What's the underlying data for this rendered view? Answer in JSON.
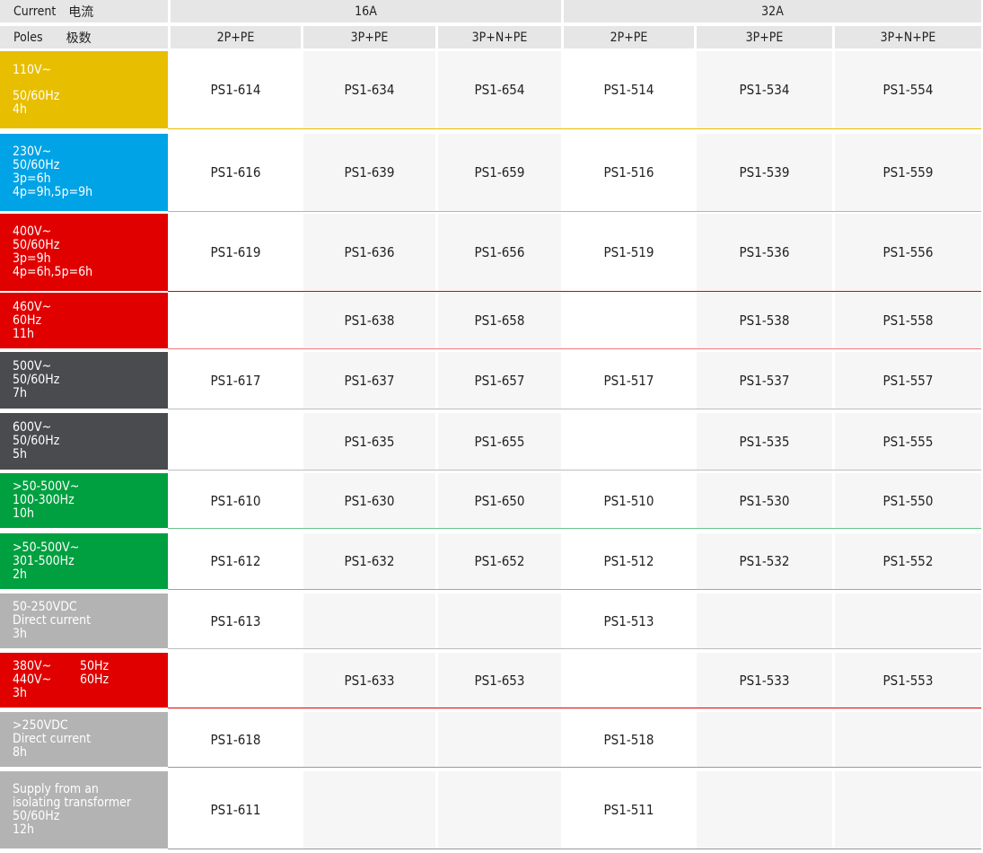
{
  "header": {
    "current_label": "Current",
    "current_cn": "电流",
    "poles_label": "Poles",
    "poles_cn": "极数",
    "groups": [
      {
        "label": "16A",
        "poles": [
          "2P+PE",
          "3P+PE",
          "3P+N+PE"
        ]
      },
      {
        "label": "32A",
        "poles": [
          "2P+PE",
          "3P+PE",
          "3P+N+PE"
        ]
      }
    ]
  },
  "rows": [
    {
      "color": "#e8be00",
      "line_color": "#e8be00",
      "label": [
        "110V~",
        "",
        "50/60Hz",
        "4h"
      ],
      "codes": [
        "PS1-614",
        "PS1-634",
        "PS1-654",
        "PS1-514",
        "PS1-534",
        "PS1-554"
      ]
    },
    {
      "color": "#00a3e6",
      "line_color": "#73c9ee",
      "label": [
        "230V~",
        "50/60Hz",
        "3p=6h",
        "4p=9h,5p=9h"
      ],
      "codes": [
        "PS1-616",
        "PS1-639",
        "PS1-659",
        "PS1-516",
        "PS1-539",
        "PS1-559"
      ]
    },
    {
      "color": "#e10000",
      "line_color": "#e10000",
      "label": [
        "400V~",
        "50/60Hz",
        "3p=9h",
        "4p=6h,5p=6h"
      ],
      "codes": [
        "PS1-619",
        "PS1-636",
        "PS1-656",
        "PS1-519",
        "PS1-536",
        "PS1-556"
      ]
    },
    {
      "color": "#e10000",
      "line_color": "#f07a7a",
      "label": [
        "460V~",
        "60Hz",
        "11h"
      ],
      "codes": [
        "",
        "PS1-638",
        "PS1-658",
        "",
        "PS1-538",
        "PS1-558"
      ]
    },
    {
      "color": "#4a4b4e",
      "line_color": "#bdbdbd",
      "label": [
        "500V~",
        "50/60Hz",
        "7h"
      ],
      "codes": [
        "PS1-617",
        "PS1-637",
        "PS1-657",
        "PS1-517",
        "PS1-537",
        "PS1-557"
      ]
    },
    {
      "color": "#4a4b4e",
      "line_color": "#bdbdbd",
      "label": [
        "600V~",
        "50/60Hz",
        "5h"
      ],
      "codes": [
        "",
        "PS1-635",
        "PS1-655",
        "",
        "PS1-535",
        "PS1-555"
      ]
    },
    {
      "color": "#00a040",
      "line_color": "#6cc48f",
      "label": [
        ">50-500V~",
        "100-300Hz",
        "10h"
      ],
      "codes": [
        "PS1-610",
        "PS1-630",
        "PS1-650",
        "PS1-510",
        "PS1-530",
        "PS1-550"
      ]
    },
    {
      "color": "#00a040",
      "line_color": "#6cc48f",
      "label": [
        ">50-500V~",
        "301-500Hz",
        "2h"
      ],
      "codes": [
        "PS1-612",
        "PS1-632",
        "PS1-652",
        "PS1-512",
        "PS1-532",
        "PS1-552"
      ]
    },
    {
      "color": "#b3b3b3",
      "line_color": "#bdbdbd",
      "label": [
        "50-250VDC",
        "Direct current",
        "3h"
      ],
      "codes": [
        "PS1-613",
        "",
        "",
        "PS1-513",
        "",
        ""
      ]
    },
    {
      "color": "#e10000",
      "line_color": "#e10000",
      "label": [
        "380V~",
        "440V~",
        "3h"
      ],
      "hz": [
        "50Hz",
        "60Hz"
      ],
      "codes": [
        "",
        "PS1-633",
        "PS1-653",
        "",
        "PS1-533",
        "PS1-553"
      ]
    },
    {
      "color": "#b3b3b3",
      "line_color": "#9a9a9a",
      "label": [
        ">250VDC",
        "Direct current",
        "8h"
      ],
      "codes": [
        "PS1-618",
        "",
        "",
        "PS1-518",
        "",
        ""
      ]
    },
    {
      "color": "#b3b3b3",
      "line_color": "#9a9a9a",
      "label": [
        "Supply from an",
        "isolating transformer",
        "50/60Hz",
        "12h"
      ],
      "codes": [
        "PS1-611",
        "",
        "",
        "PS1-511",
        "",
        ""
      ]
    }
  ]
}
